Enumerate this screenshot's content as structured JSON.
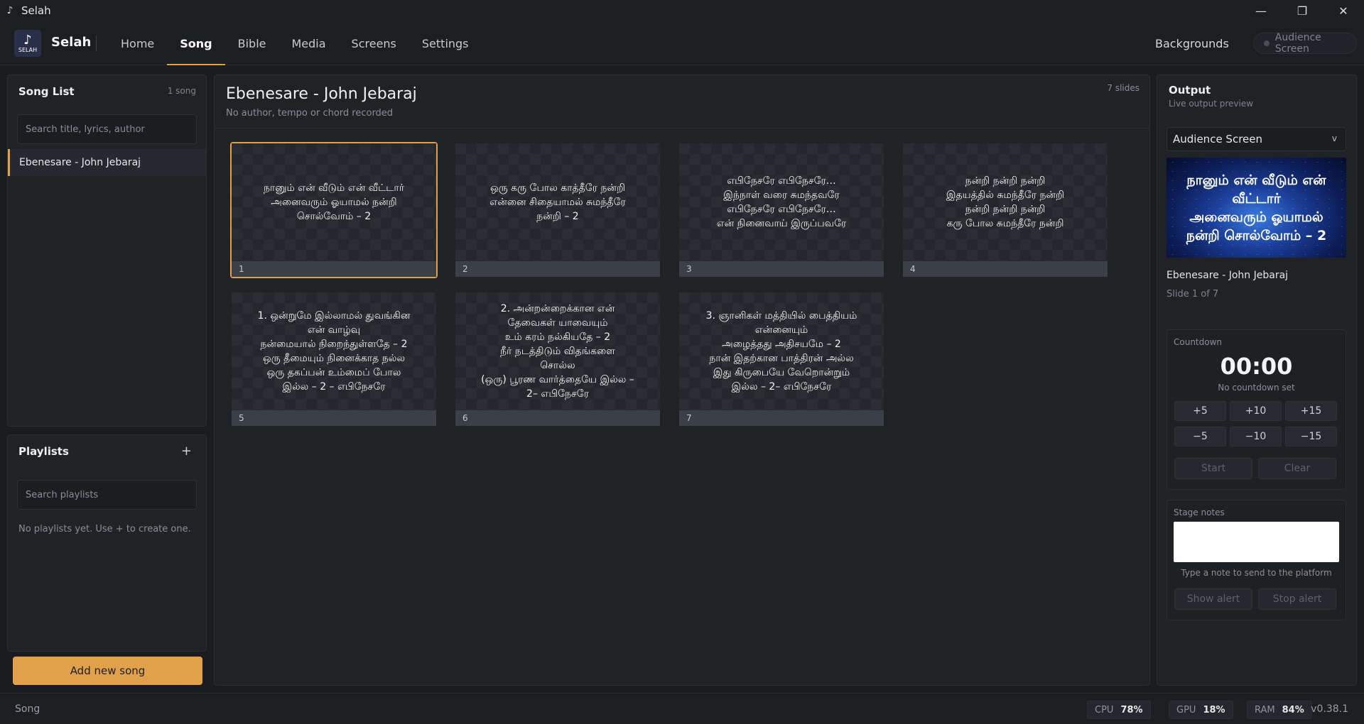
{
  "window": {
    "title": "Selah",
    "app_icon": "music-note-icon",
    "controls": [
      "minimize-icon",
      "restore-icon",
      "close-icon"
    ]
  },
  "header": {
    "brand": "Selah",
    "logo_text": "SELAH",
    "tabs": [
      {
        "label": "Home",
        "active": false
      },
      {
        "label": "Song",
        "active": true
      },
      {
        "label": "Bible",
        "active": false
      },
      {
        "label": "Media",
        "active": false
      },
      {
        "label": "Screens",
        "active": false
      },
      {
        "label": "Settings",
        "active": false
      }
    ],
    "backgrounds_label": "Backgrounds",
    "audience_screen_label": "Audience Screen"
  },
  "song_list": {
    "title": "Song List",
    "count": "1 song",
    "search_placeholder": "Search title, lyrics, author",
    "items": [
      "Ebenesare - John Jebaraj"
    ]
  },
  "playlists": {
    "title": "Playlists",
    "add_label": "+",
    "search_placeholder": "Search playlists",
    "empty_text": "No playlists yet. Use + to create one."
  },
  "add_song_label": "Add new song",
  "main": {
    "title": "Ebenesare - John Jebaraj",
    "subtitle": "No author, tempo or chord recorded",
    "slide_count": "7 slides",
    "selected_slide": 1,
    "slides": [
      {
        "number": "1",
        "text": "நானும் என் வீடும் என் வீட்டார்\nஅனைவரும் ஓயாமல் நன்றி\nசொல்வோம் – 2"
      },
      {
        "number": "2",
        "text": "ஒரு கரு போல காத்தீரே நன்றி\nஎன்னை சிதையாமல் சுமந்தீரே\nநன்றி – 2"
      },
      {
        "number": "3",
        "text": "எபிநேசரே எபிநேசரே…\nஇந்நாள் வரை சுமந்தவரே\nஎபிநேசரே எபிநேசரே…\nஎன் நினைவாய் இருப்பவரே"
      },
      {
        "number": "4",
        "text": "நன்றி நன்றி நன்றி\nஇதயத்தில் சுமந்தீரே நன்றி\nநன்றி நன்றி நன்றி\nகரு போல சுமந்தீரே நன்றி"
      },
      {
        "number": "5",
        "text": "1. ஒன்றுமே இல்லாமல் துவங்கின\nஎன் வாழ்வு\nநன்மையால் நிறைந்துள்ளதே – 2\nஒரு தீமையும் நினைக்காத நல்ல\nஒரு தகப்பன் உம்மைப் போல\nஇல்ல – 2 – எபிநேசரே"
      },
      {
        "number": "6",
        "text": "2. அன்றன்றைக்கான என்\nதேவைகள் யாவையும்\nஉம் கரம் நல்கியதே – 2\nநீர் நடத்திடும் விதங்களை\nசொல்ல\n(ஒரு) பூரண வார்த்தையே இல்ல –\n2– எபிநேசரே"
      },
      {
        "number": "7",
        "text": "3. ஞானிகள் மத்தியில் பைத்தியம்\nஎன்னையும்\nஅழைத்தது அதிசயமே – 2\nநான் இதற்கான பாத்திரன் அல்ல\nஇது கிருபையே வேறொன்றும்\nஇல்ல – 2– எபிநேசரே"
      }
    ]
  },
  "output": {
    "title": "Output",
    "subtitle": "Live output preview",
    "screen_select": "Audience Screen",
    "preview_text": "நானும் என் வீடும் என்\nவீட்டார்\nஅனைவரும் ஓயாமல்\nநன்றி சொல்வோம் – 2",
    "song": "Ebenesare - John Jebaraj",
    "slide_position": "Slide 1 of 7"
  },
  "countdown": {
    "label": "Countdown",
    "time": "00:00",
    "status": "No countdown set",
    "buttons": [
      "+5",
      "+10",
      "+15",
      "−5",
      "−10",
      "−15"
    ],
    "start_label": "Start",
    "clear_label": "Clear"
  },
  "stage_notes": {
    "label": "Stage notes",
    "hint": "Type a note to send to the platform",
    "show_label": "Show alert",
    "stop_label": "Stop alert"
  },
  "status": {
    "section": "Song",
    "cpu_label": "CPU",
    "cpu_value": "78%",
    "gpu_label": "GPU",
    "gpu_value": "18%",
    "ram_label": "RAM",
    "ram_value": "84%",
    "version": "v0.38.1"
  },
  "colors": {
    "accent": "#e1a14b",
    "background": "#1a1c20",
    "panel": "#202226"
  }
}
